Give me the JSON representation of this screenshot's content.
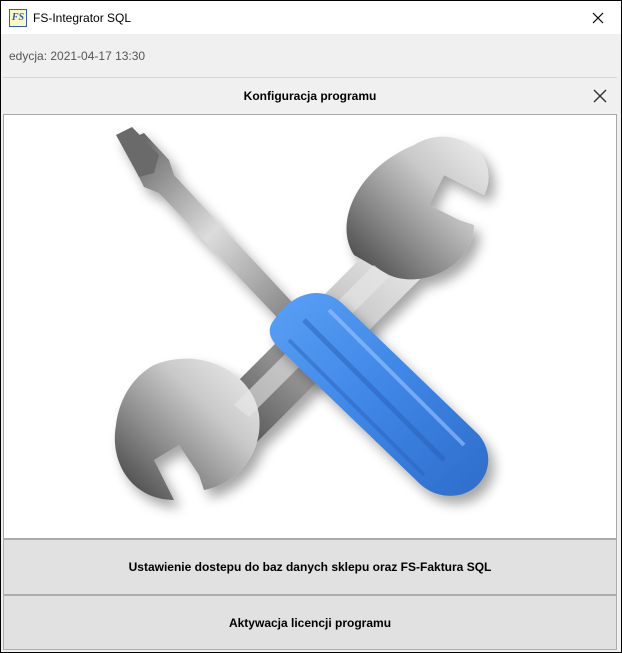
{
  "window": {
    "title": "FS-Integrator SQL",
    "app_icon_text": "FS"
  },
  "edition": {
    "text": "edycja: 2021-04-17 13:30"
  },
  "header": {
    "title": "Konfiguracja programu"
  },
  "illustration": {
    "icon": "tools-wrench-screwdriver-icon"
  },
  "buttons": {
    "db_access_label": "Ustawienie dostepu do baz danych sklepu oraz FS-Faktura SQL",
    "license_label": "Aktywacja licencji programu"
  },
  "colors": {
    "screwdriver_handle": "#3f86e6",
    "metal": "#9a9a9a"
  }
}
